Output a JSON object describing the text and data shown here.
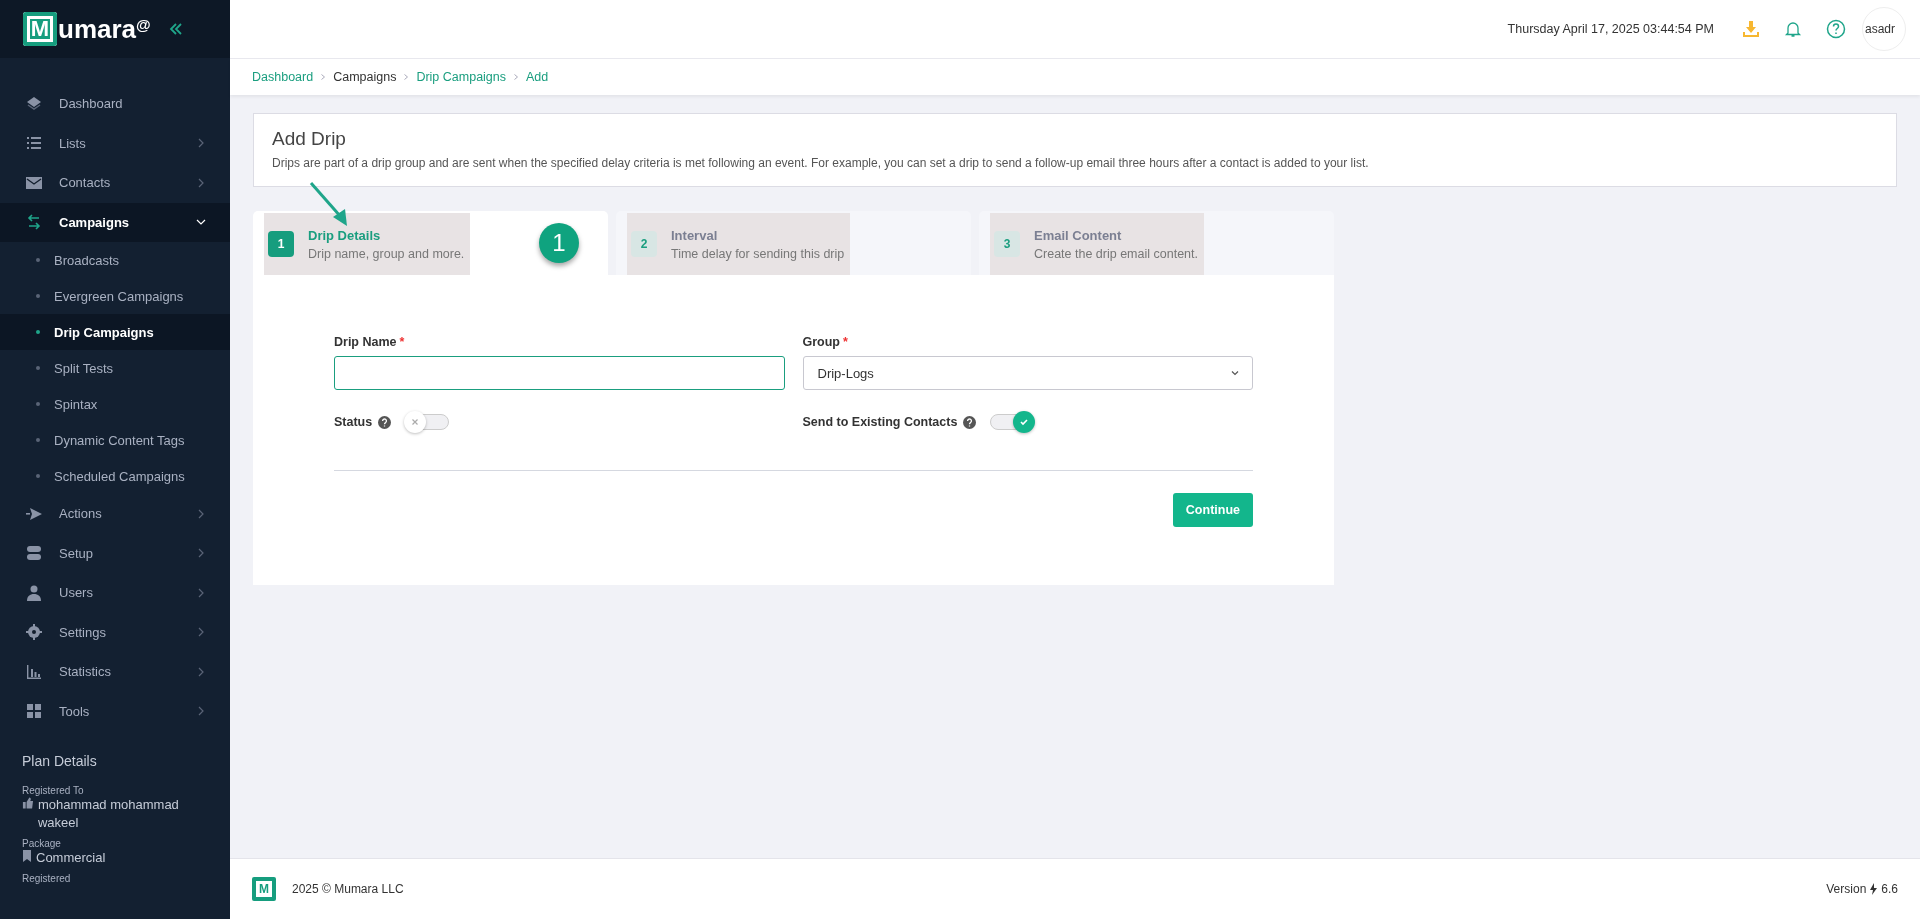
{
  "logo": {
    "letter": "M",
    "text": "umara",
    "mark": "@"
  },
  "sidebar": {
    "items": [
      {
        "label": "Dashboard",
        "kind": "section",
        "selected": false,
        "has_children": false
      },
      {
        "label": "Lists",
        "kind": "section",
        "selected": false,
        "expanded": false,
        "has_children": true
      },
      {
        "label": "Contacts",
        "kind": "section",
        "selected": false,
        "expanded": false,
        "has_children": true
      },
      {
        "label": "Campaigns",
        "kind": "section",
        "selected": true,
        "expanded": true,
        "has_children": true
      },
      {
        "label": "Broadcasts",
        "kind": "sub",
        "selected": false
      },
      {
        "label": "Evergreen Campaigns",
        "kind": "sub",
        "selected": false
      },
      {
        "label": "Drip Campaigns",
        "kind": "sub",
        "selected": true
      },
      {
        "label": "Split Tests",
        "kind": "sub",
        "selected": false
      },
      {
        "label": "Spintax",
        "kind": "sub",
        "selected": false
      },
      {
        "label": "Dynamic Content Tags",
        "kind": "sub",
        "selected": false
      },
      {
        "label": "Scheduled Campaigns",
        "kind": "sub",
        "selected": false
      },
      {
        "label": "Actions",
        "kind": "section",
        "selected": false,
        "expanded": false,
        "has_children": true
      },
      {
        "label": "Setup",
        "kind": "section",
        "selected": false,
        "expanded": false,
        "has_children": true
      },
      {
        "label": "Users",
        "kind": "section",
        "selected": false,
        "expanded": false,
        "has_children": true
      },
      {
        "label": "Settings",
        "kind": "section",
        "selected": false,
        "expanded": false,
        "has_children": true
      },
      {
        "label": "Statistics",
        "kind": "section",
        "selected": false,
        "expanded": false,
        "has_children": true
      },
      {
        "label": "Tools",
        "kind": "section",
        "selected": false,
        "expanded": false,
        "has_children": true
      }
    ],
    "plan": {
      "title": "Plan Details",
      "fields": [
        {
          "label": "Registered To",
          "value": "mohammad mohammad wakeel"
        },
        {
          "label": "Package",
          "value": "Commercial"
        },
        {
          "label": "Registered"
        }
      ]
    }
  },
  "topbar": {
    "datetime": "Thursday April 17, 2025 03:44:54 PM",
    "avatar_alt": "asadr"
  },
  "breadcrumb": [
    {
      "label": "Dashboard",
      "link": true
    },
    {
      "label": "Campaigns",
      "link": false
    },
    {
      "label": "Drip Campaigns",
      "link": true
    },
    {
      "label": "Add",
      "link": true
    }
  ],
  "page": {
    "title": "Add Drip",
    "description": "Drips are part of a drip group and are sent when the specified delay criteria is met following an event. For example, you can set a drip to send a follow-up email three hours after a contact is added to your list."
  },
  "steps": [
    {
      "number": "1",
      "title": "Drip Details",
      "subtitle": "Drip name, group and more.",
      "selected": true
    },
    {
      "number": "2",
      "title": "Interval",
      "subtitle": "Time delay for sending this drip",
      "selected": false
    },
    {
      "number": "3",
      "title": "Email Content",
      "subtitle": "Create the drip email content.",
      "selected": false
    }
  ],
  "annotation": {
    "badge": "1"
  },
  "form": {
    "drip_name": {
      "label": "Drip Name",
      "required_mark": "*"
    },
    "group": {
      "label": "Group",
      "required_mark": "*",
      "value": "Drip-Logs"
    },
    "status": {
      "label": "Status",
      "on": false
    },
    "send_existing": {
      "label": "Send to Existing Contacts",
      "on": true
    },
    "submit": "Continue"
  },
  "footer": {
    "logo_letter": "M",
    "copyright": "2025 © Mumara LLC",
    "version_label": "Version",
    "version": "6.6"
  }
}
